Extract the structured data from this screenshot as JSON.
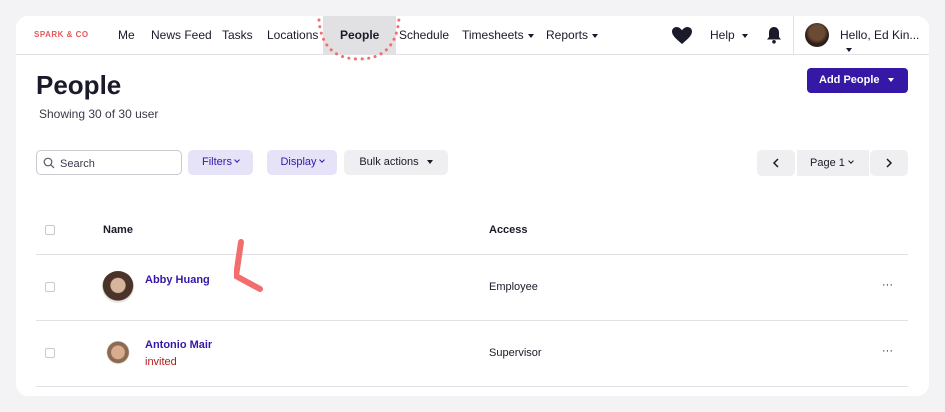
{
  "nav": {
    "brand": "SPARK & CO",
    "items": [
      {
        "label": "Me"
      },
      {
        "label": "News Feed"
      },
      {
        "label": "Tasks"
      },
      {
        "label": "Locations"
      },
      {
        "label": "People"
      },
      {
        "label": "Schedule"
      },
      {
        "label": "Timesheets"
      },
      {
        "label": "Reports"
      }
    ],
    "help": "Help",
    "greeting": "Hello, Ed Kin..."
  },
  "header": {
    "title": "People",
    "subtitle": "Showing 30 of 30 user",
    "add_button": "Add People"
  },
  "toolbar": {
    "search_placeholder": "Search",
    "filters": "Filters",
    "display": "Display",
    "bulk_actions": "Bulk actions",
    "page_label": "Page 1"
  },
  "table": {
    "columns": [
      "Name",
      "Access"
    ],
    "rows": [
      {
        "name": "Abby Huang",
        "status": "",
        "access": "Employee",
        "menu": "···"
      },
      {
        "name": "Antonio Mair",
        "status": "invited",
        "access": "Supervisor",
        "menu": "···"
      }
    ]
  },
  "colors": {
    "accent": "#3618a6",
    "brand": "#e8585a",
    "annotation": "#f26d6d",
    "invited": "#b01c1c"
  }
}
